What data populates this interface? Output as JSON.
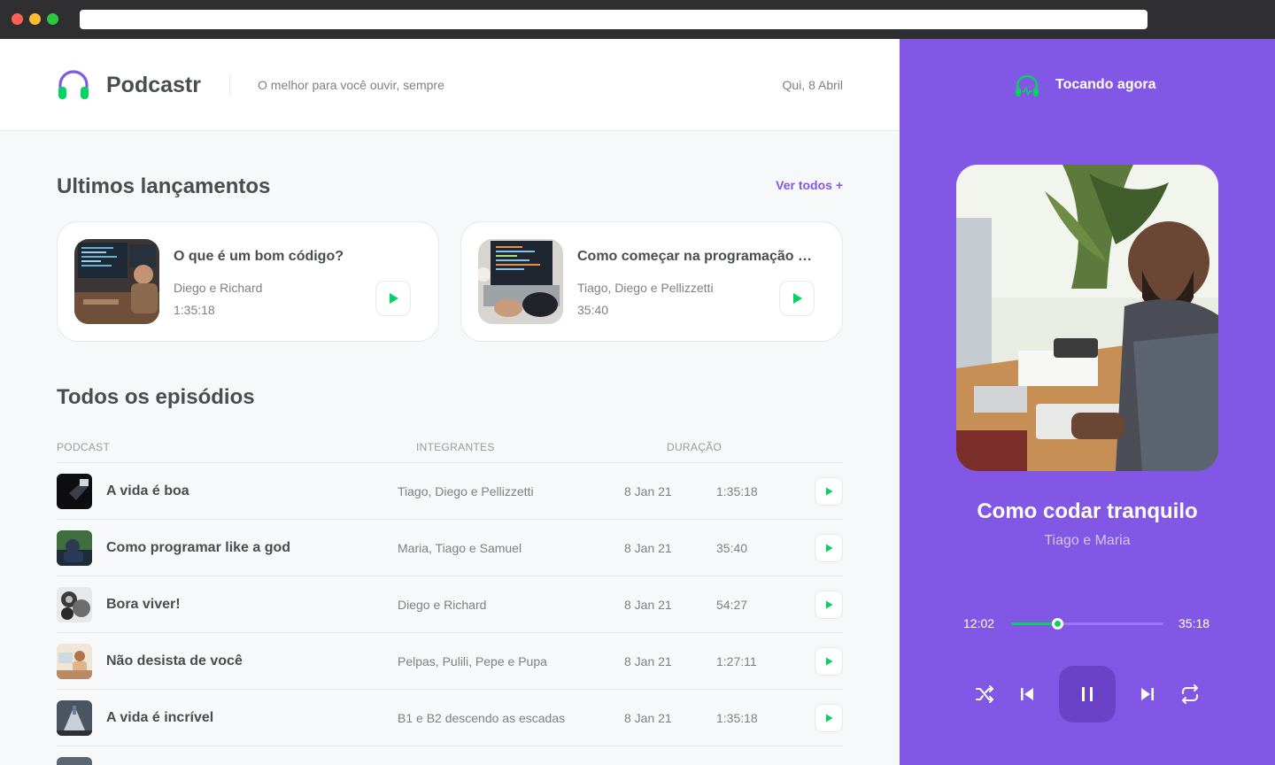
{
  "app": {
    "name": "Podcastr",
    "tagline": "O melhor para você ouvir, sempre",
    "date": "Qui, 8 Abril"
  },
  "latest": {
    "title": "Ultimos lançamentos",
    "see_all": "Ver todos +",
    "items": [
      {
        "title": "O que é um bom código?",
        "members": "Diego e Richard",
        "duration": "1:35:18"
      },
      {
        "title": "Como começar na programação do jeito certo",
        "members": "Tiago, Diego e Pellizzetti",
        "duration": "35:40"
      }
    ]
  },
  "all": {
    "title": "Todos os episódios",
    "columns": {
      "podcast": "PODCAST",
      "members": "INTEGRANTES",
      "duration": "DURAÇÃO"
    },
    "rows": [
      {
        "title": "A vida é boa",
        "members": "Tiago, Diego e Pellizzetti",
        "date": "8 Jan 21",
        "duration": "1:35:18"
      },
      {
        "title": "Como programar like a god",
        "members": "Maria, Tiago e Samuel",
        "date": "8 Jan 21",
        "duration": "35:40"
      },
      {
        "title": "Bora viver!",
        "members": "Diego e Richard",
        "date": "8 Jan 21",
        "duration": "54:27"
      },
      {
        "title": "Não desista de você",
        "members": "Pelpas, Pulili, Pepe e Pupa",
        "date": "8 Jan 21",
        "duration": "1:27:11"
      },
      {
        "title": "A vida é incrível",
        "members": "B1 e B2 descendo as escadas",
        "date": "8 Jan 21",
        "duration": "1:35:18"
      }
    ]
  },
  "player": {
    "header": "Tocando agora",
    "title": "Como codar tranquilo",
    "members": "Tiago e Maria",
    "current_time": "12:02",
    "total_time": "35:18",
    "progress": 0.3
  },
  "colors": {
    "purple": "#8257e5",
    "green": "#04d361"
  },
  "icons": {
    "logo": "headphones-icon",
    "play": "play-icon",
    "shuffle": "shuffle-icon",
    "previous": "skip-previous-icon",
    "pause": "pause-icon",
    "next": "skip-next-icon",
    "repeat": "repeat-icon"
  }
}
